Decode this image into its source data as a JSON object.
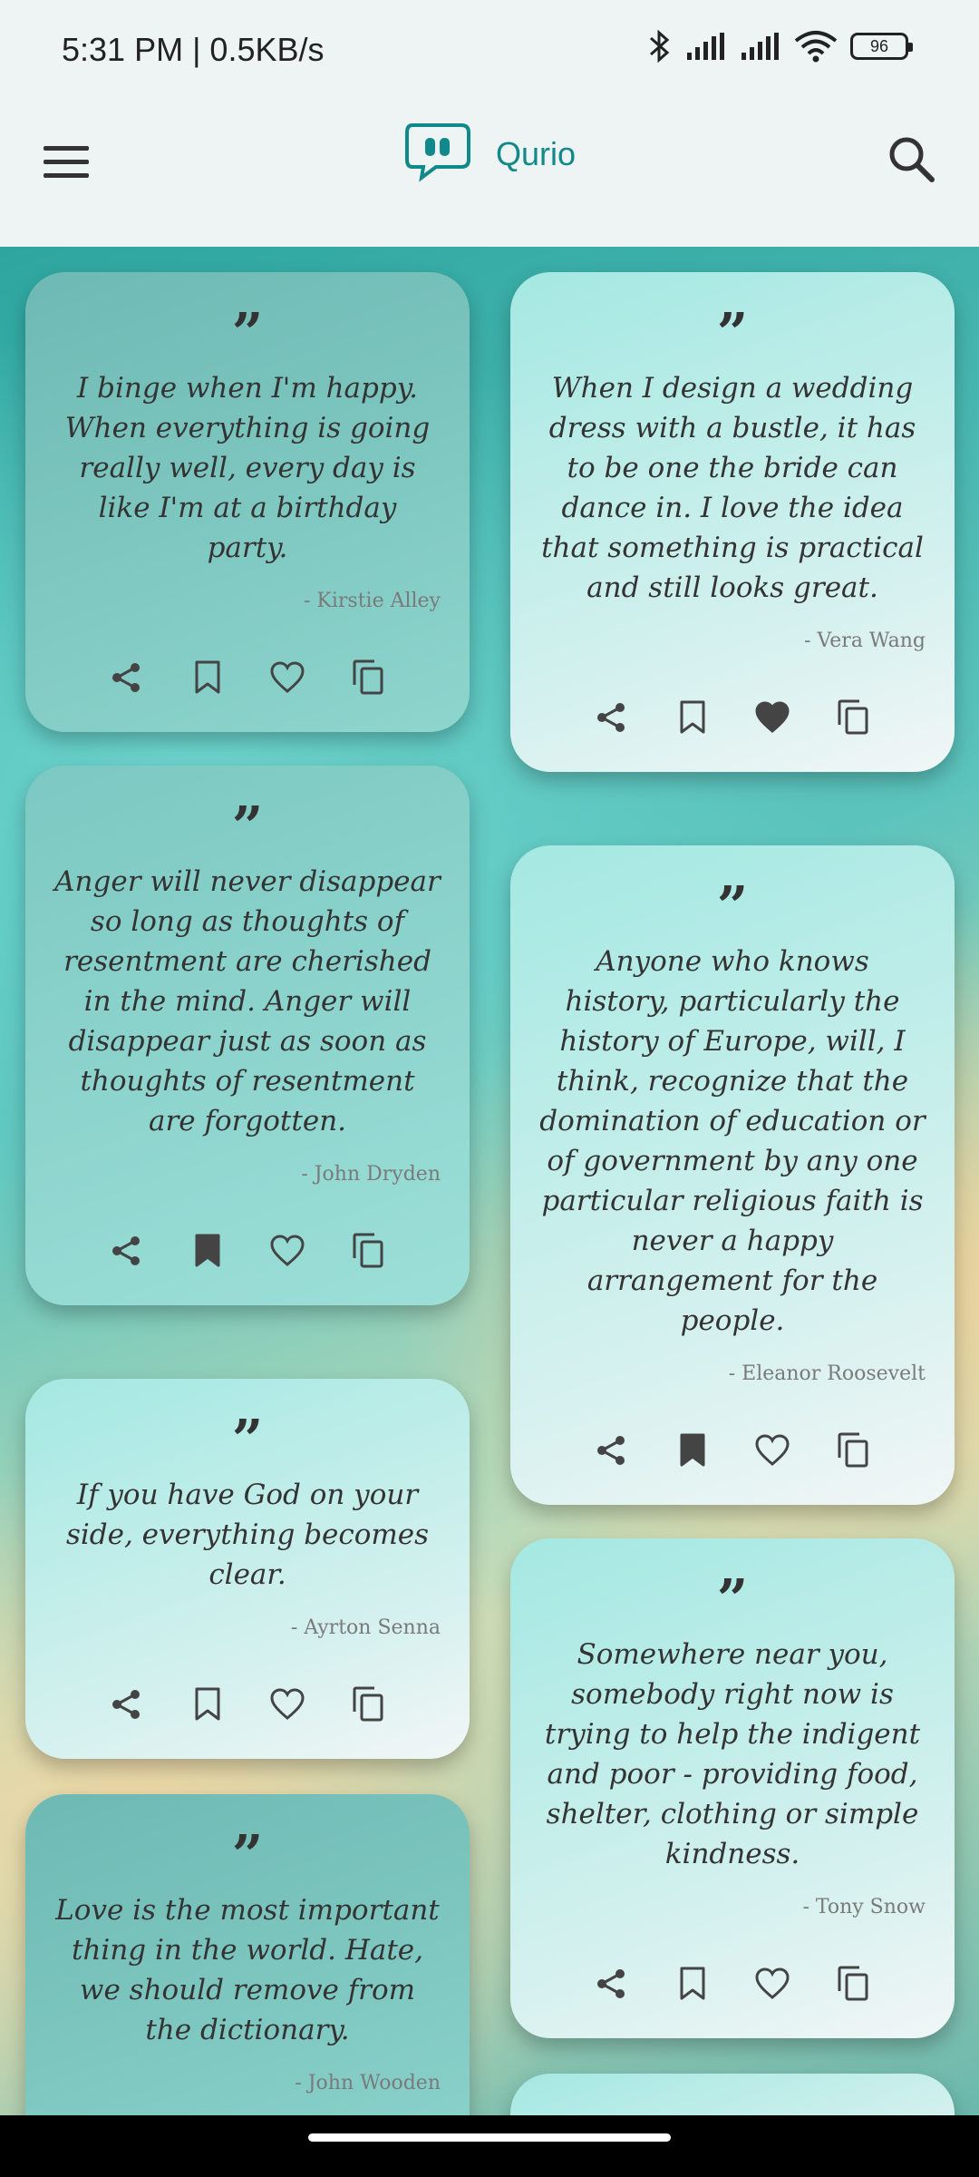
{
  "status": {
    "time": "5:31 PM | 0.5KB/s",
    "battery": "96"
  },
  "app": {
    "title": "Qurio",
    "accent": "#11898A"
  },
  "quote_mark": "”",
  "quotes": [
    {
      "text": "I binge when I'm happy. When everything is going really well, every day is like I'm at a birthday party.",
      "author": "- Kirstie Alley",
      "bookmarked": false,
      "liked": false
    },
    {
      "text": "When I design a wedding dress with a bustle, it has to be one the bride can dance in. I love the idea that something is practical and still looks great.",
      "author": "- Vera Wang",
      "bookmarked": false,
      "liked": true
    },
    {
      "text": "Anger will never disappear so long as thoughts of resentment are cherished in the mind. Anger will disappear just as soon as thoughts of resentment are forgotten.",
      "author": "- John Dryden",
      "bookmarked": true,
      "liked": false
    },
    {
      "text": "Anyone who knows history, particularly the history of Europe, will, I think, recognize that the domination of education or of government by any one particular religious faith is never a happy arrangement for the people.",
      "author": "- Eleanor Roosevelt",
      "bookmarked": true,
      "liked": false
    },
    {
      "text": "If you have God on your side, everything becomes clear.",
      "author": "- Ayrton Senna",
      "bookmarked": false,
      "liked": false
    },
    {
      "text": "Somewhere near you, somebody right now is trying to help the indigent and poor - providing food, shelter, clothing or simple kindness.",
      "author": "- Tony Snow",
      "bookmarked": false,
      "liked": false
    },
    {
      "text": "Love is the most important thing in the world. Hate, we should remove from the dictionary.",
      "author": "- John Wooden",
      "bookmarked": false,
      "liked": false
    }
  ]
}
